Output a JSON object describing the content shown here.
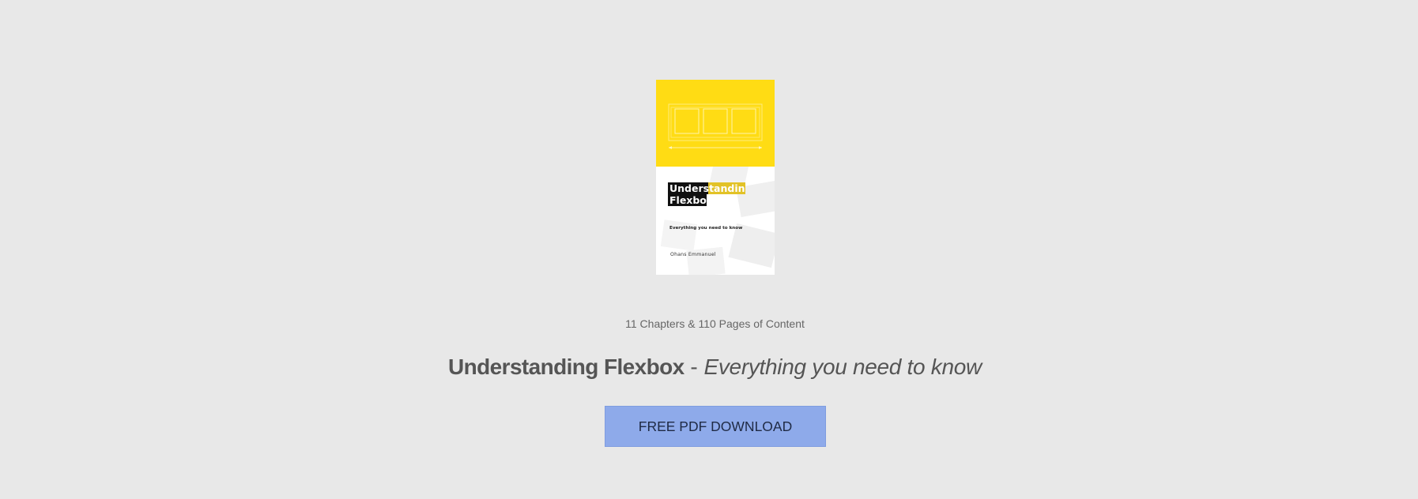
{
  "cover": {
    "title_line1": "Understanding",
    "title_line2": "Flexbox",
    "subtitle": "Everything you need to know",
    "author": "Ohans Emmanuel",
    "accent_color": "#ffdc14"
  },
  "meta": {
    "content_summary": "11 Chapters & 110 Pages of Content"
  },
  "headline": {
    "title": "Understanding Flexbox",
    "separator": " - ",
    "tagline": "Everything you need to know"
  },
  "cta": {
    "label": "FREE PDF DOWNLOAD",
    "color": "#8eaaea"
  }
}
